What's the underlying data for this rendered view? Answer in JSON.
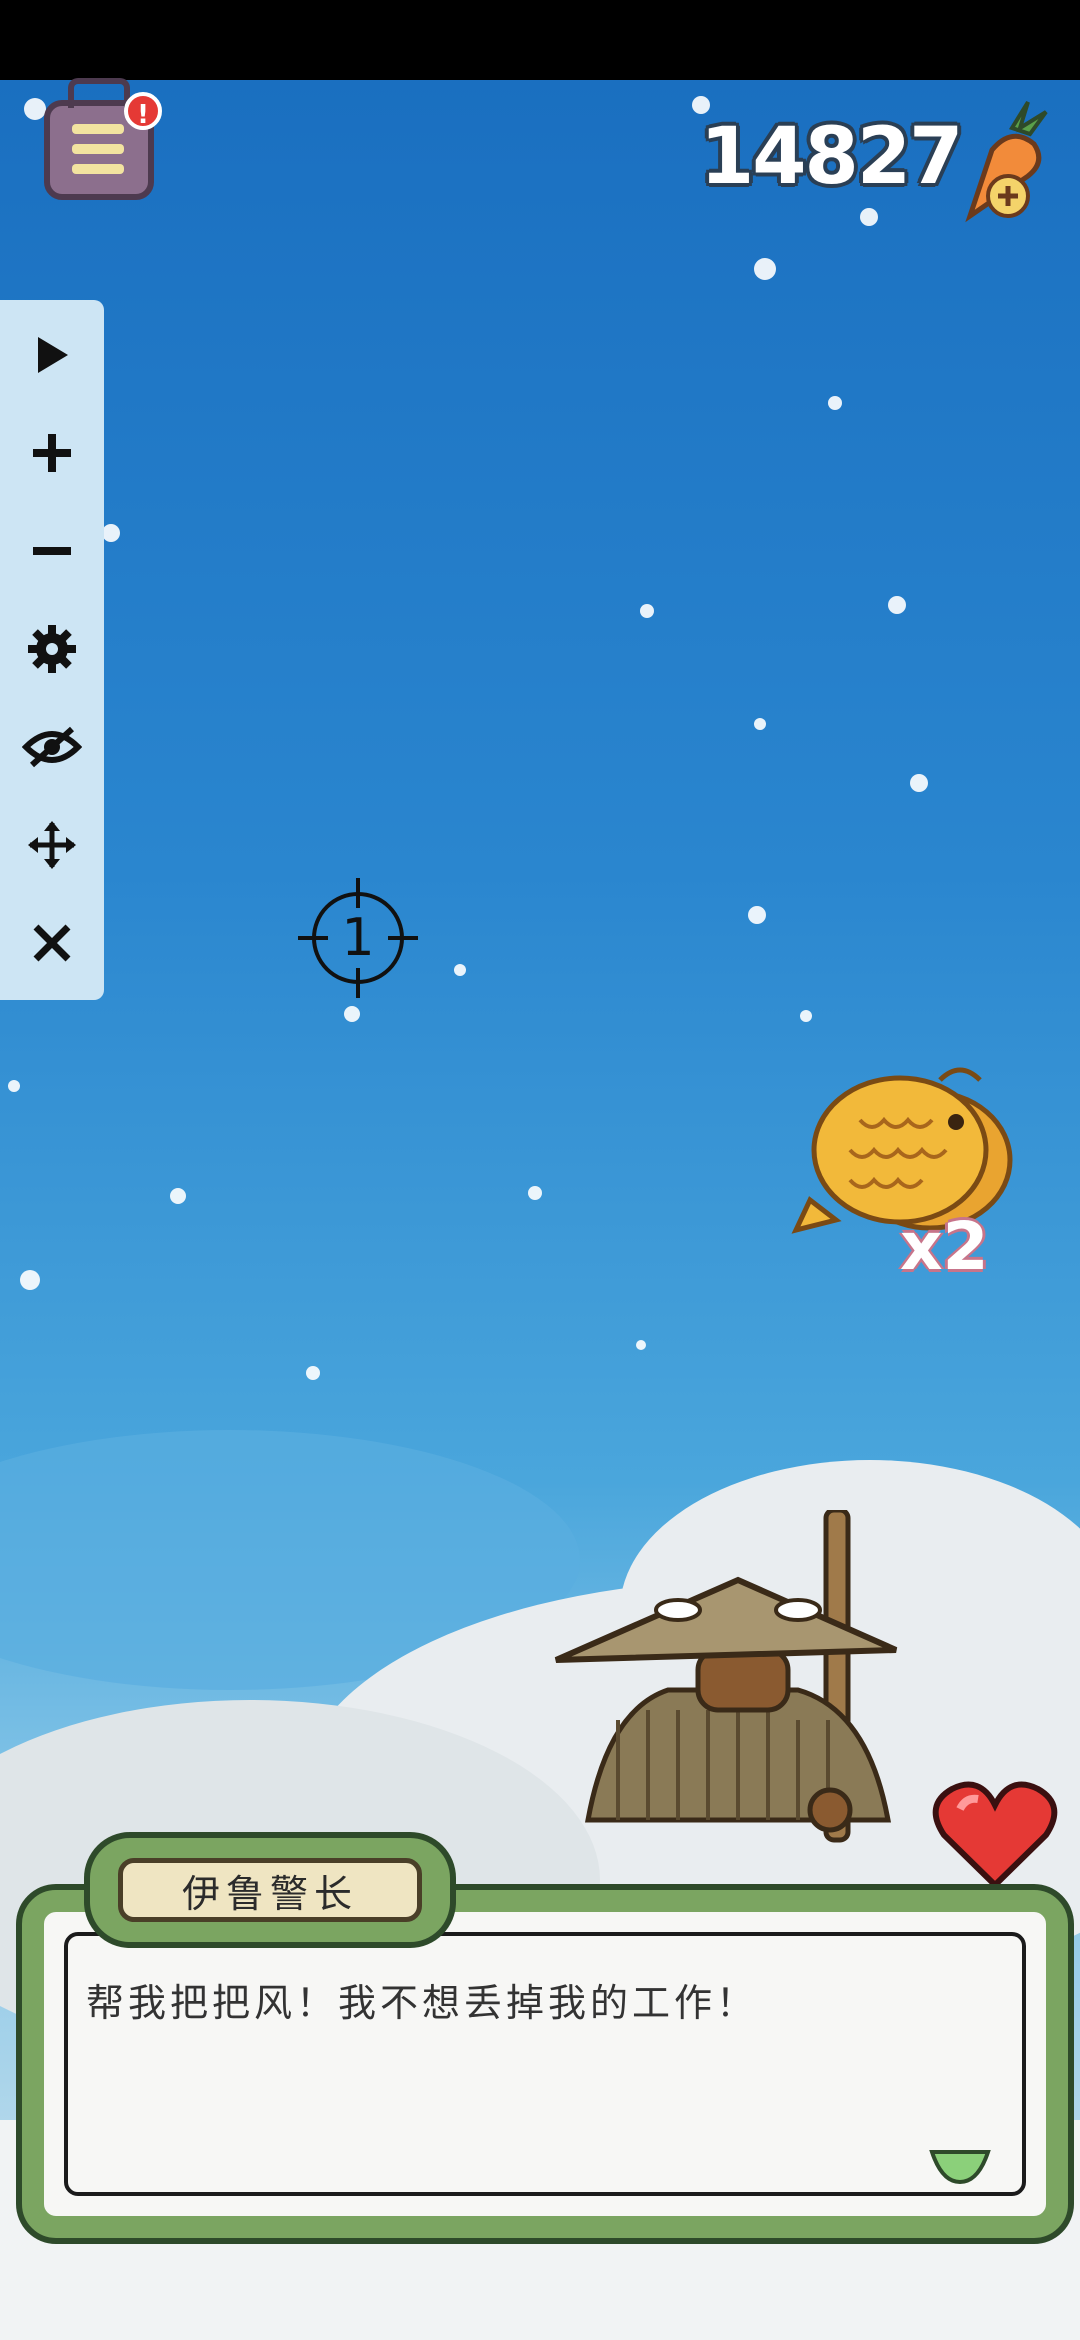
{
  "hud": {
    "currency_amount": "14827",
    "menu_icon": "journal-menu-icon",
    "alert_badge": "!",
    "currency_icon": "carrot-add-icon"
  },
  "toolbar": {
    "items": [
      {
        "name": "play-icon",
        "glyph": "▶"
      },
      {
        "name": "zoom-in-icon",
        "glyph": "+"
      },
      {
        "name": "zoom-out-icon",
        "glyph": "−"
      },
      {
        "name": "settings-gear-icon",
        "glyph": "⚙"
      },
      {
        "name": "hide-eye-icon",
        "glyph": "◎"
      },
      {
        "name": "move-arrows-icon",
        "glyph": "✥"
      },
      {
        "name": "close-icon",
        "glyph": "✕"
      }
    ]
  },
  "crosshair": {
    "label": "1"
  },
  "reward": {
    "item_icon": "taiyaki-fish-cake-icon",
    "multiplier": "x2"
  },
  "dialog": {
    "speaker_name": "伊鲁警长",
    "message": "帮我把把风！我不想丢掉我的工作！",
    "continue_icon": "continue-arrow-icon"
  },
  "colors": {
    "sky_top": "#1a6fc0",
    "dialog_border": "#7ba561",
    "nameplate_bg": "#efe5c2",
    "heart": "#e53935"
  }
}
